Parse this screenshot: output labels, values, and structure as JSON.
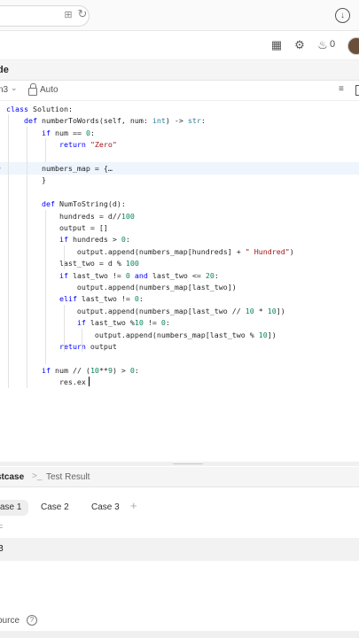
{
  "browser": {
    "translate_icon": "translate-icon",
    "reload_icon": "reload-icon",
    "download_icon": "download-icon"
  },
  "header": {
    "streak_count": "0",
    "icons": [
      "layout-icon",
      "gear-icon",
      "fire-icon",
      "avatar"
    ]
  },
  "panel": {
    "title": "de"
  },
  "toolbar": {
    "language": "n3",
    "mode": "Auto"
  },
  "code": {
    "lines": [
      "class Solution:",
      "    def numberToWords(self, num: int) -> str:",
      "        if num == 0:",
      "            return \"Zero\"",
      "",
      "        numbers_map = {…",
      "        }",
      "",
      "        def NumToString(d):",
      "            hundreds = d//100",
      "            output = []",
      "            if hundreds > 0:",
      "                output.append(numbers_map[hundreds] + \" Hundred\")",
      "            last_two = d % 100",
      "            if last_two != 0 and last_two <= 20:",
      "                output.append(numbers_map[last_two])",
      "            elif last_two != 0:",
      "                output.append(numbers_map[last_two // 10 * 10])",
      "                if last_two %10 != 0:",
      "                    output.append(numbers_map[last_two % 10])",
      "            return output",
      "",
      "        if num // (10**9) > 0:",
      "            res.ex"
    ],
    "active_line": 5
  },
  "bottom": {
    "tab_testcase": "stcase",
    "tab_test_result": "Test Result",
    "cases": [
      "ase 1",
      "Case 2",
      "Case 3"
    ],
    "add_case": "+",
    "param_label": "=",
    "input_value": "3",
    "source": "ource",
    "help": "?"
  },
  "colors": {
    "keyword": "#0000ff",
    "string": "#a31515",
    "number": "#098658",
    "active_line": "#eef5fd"
  }
}
